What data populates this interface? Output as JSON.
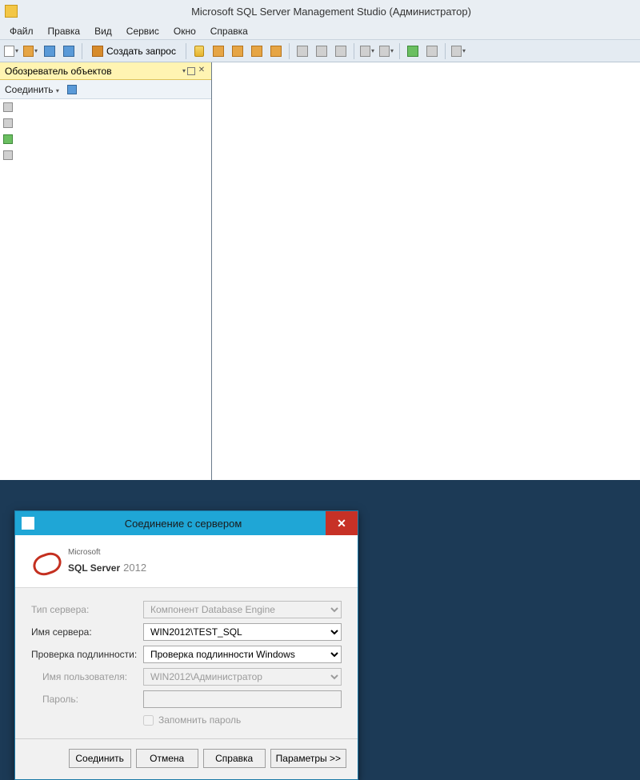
{
  "title": "Microsoft SQL Server Management Studio (Администратор)",
  "menu": {
    "file": "Файл",
    "edit": "Правка",
    "view": "Вид",
    "tools": "Сервис",
    "window": "Окно",
    "help": "Справка"
  },
  "toolbar": {
    "new_query": "Создать запрос"
  },
  "object_explorer": {
    "title": "Обозреватель объектов",
    "connect": "Соединить"
  },
  "dialog": {
    "title": "Соединение с сервером",
    "logo": {
      "ms": "Microsoft",
      "product": "SQL Server",
      "year": "2012"
    },
    "labels": {
      "server_type": "Тип сервера:",
      "server_name": "Имя сервера:",
      "auth": "Проверка подлинности:",
      "username": "Имя пользователя:",
      "password": "Пароль:",
      "remember": "Запомнить пароль"
    },
    "values": {
      "server_type": "Компонент Database Engine",
      "server_name": "WIN2012\\TEST_SQL",
      "auth": "Проверка подлинности Windows",
      "username": "WIN2012\\Администратор",
      "password": ""
    },
    "buttons": {
      "connect": "Соединить",
      "cancel": "Отмена",
      "help": "Справка",
      "options": "Параметры >>"
    }
  }
}
